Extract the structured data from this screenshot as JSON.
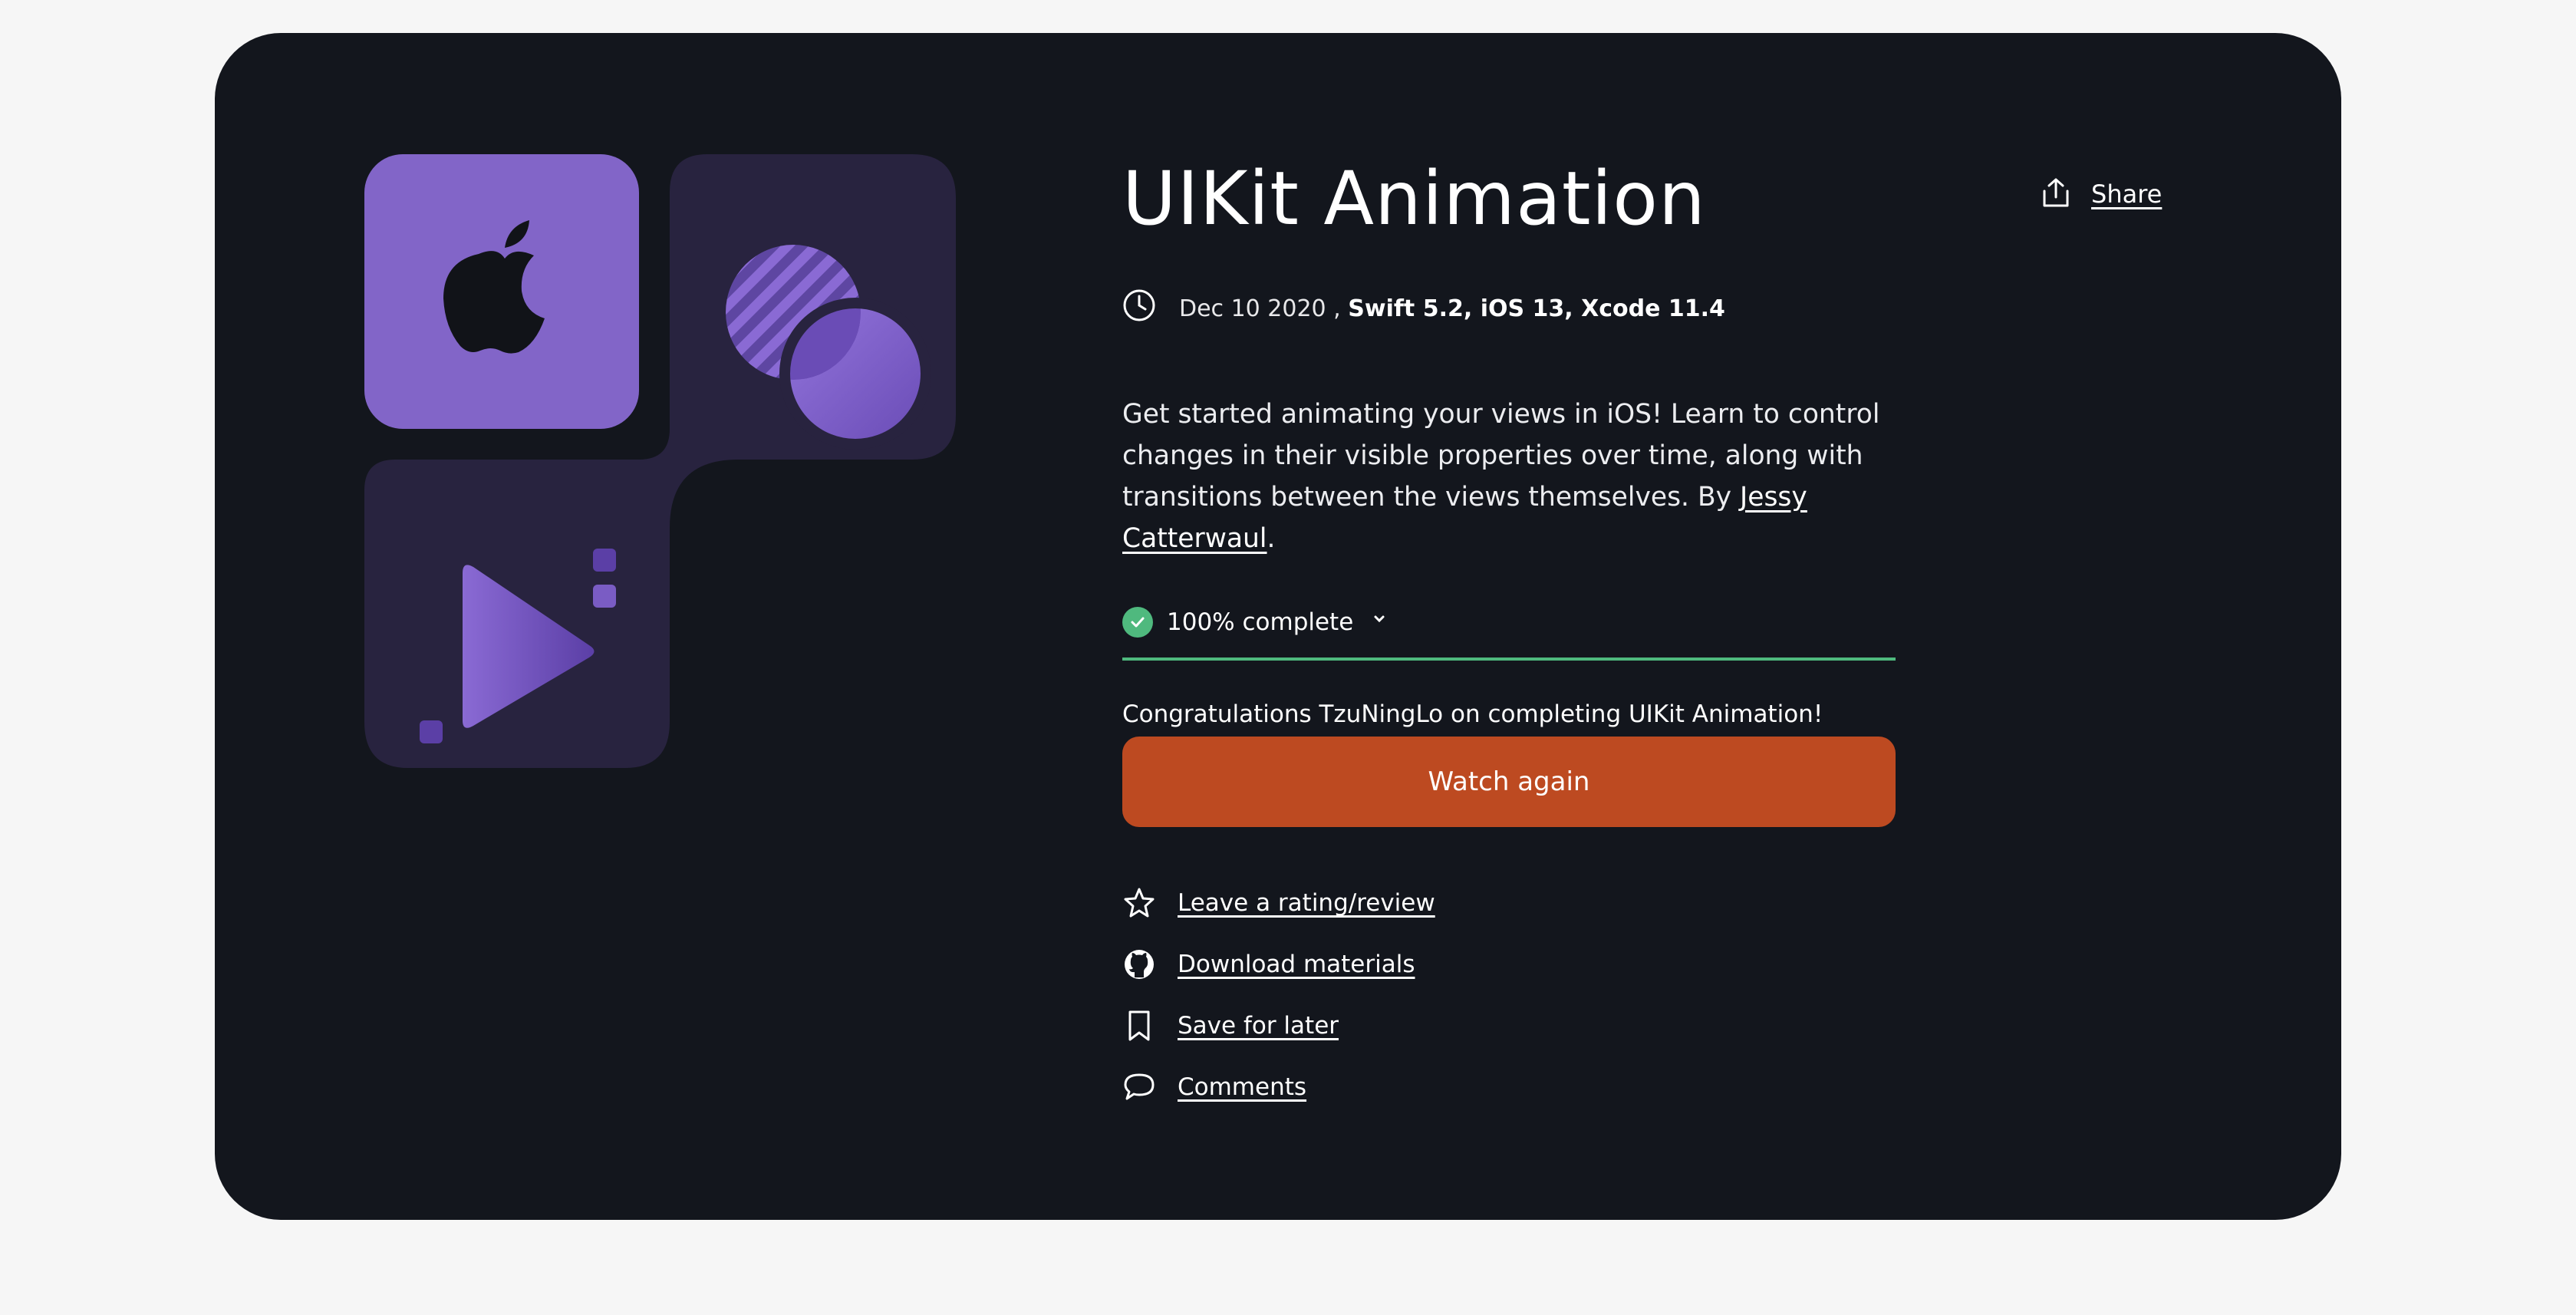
{
  "course": {
    "title": "UIKit Animation",
    "share_label": "Share",
    "date": "Dec 10 2020 ,",
    "tech": "Swift 5.2, iOS 13, Xcode 11.4",
    "description_before": "Get started animating your views in iOS! Learn to control changes in their visible properties over time, along with transitions between the views themselves. By ",
    "author": "Jessy Catterwaul",
    "description_after": "."
  },
  "progress": {
    "label": "100% complete",
    "percent": 100
  },
  "congrats_text": "Congratulations TzuNingLo on completing UIKit Animation!",
  "watch_button_label": "Watch again",
  "actions": [
    {
      "label": "Leave a rating/review",
      "icon": "star-icon"
    },
    {
      "label": "Download materials",
      "icon": "github-icon"
    },
    {
      "label": "Save for later",
      "icon": "bookmark-icon"
    },
    {
      "label": "Comments",
      "icon": "comment-icon"
    }
  ],
  "colors": {
    "card_bg": "#13161d",
    "accent_purple": "#8265c8",
    "dark_tile": "#28233f",
    "success_green": "#4fb97e",
    "cta_orange": "#bd4a21"
  }
}
